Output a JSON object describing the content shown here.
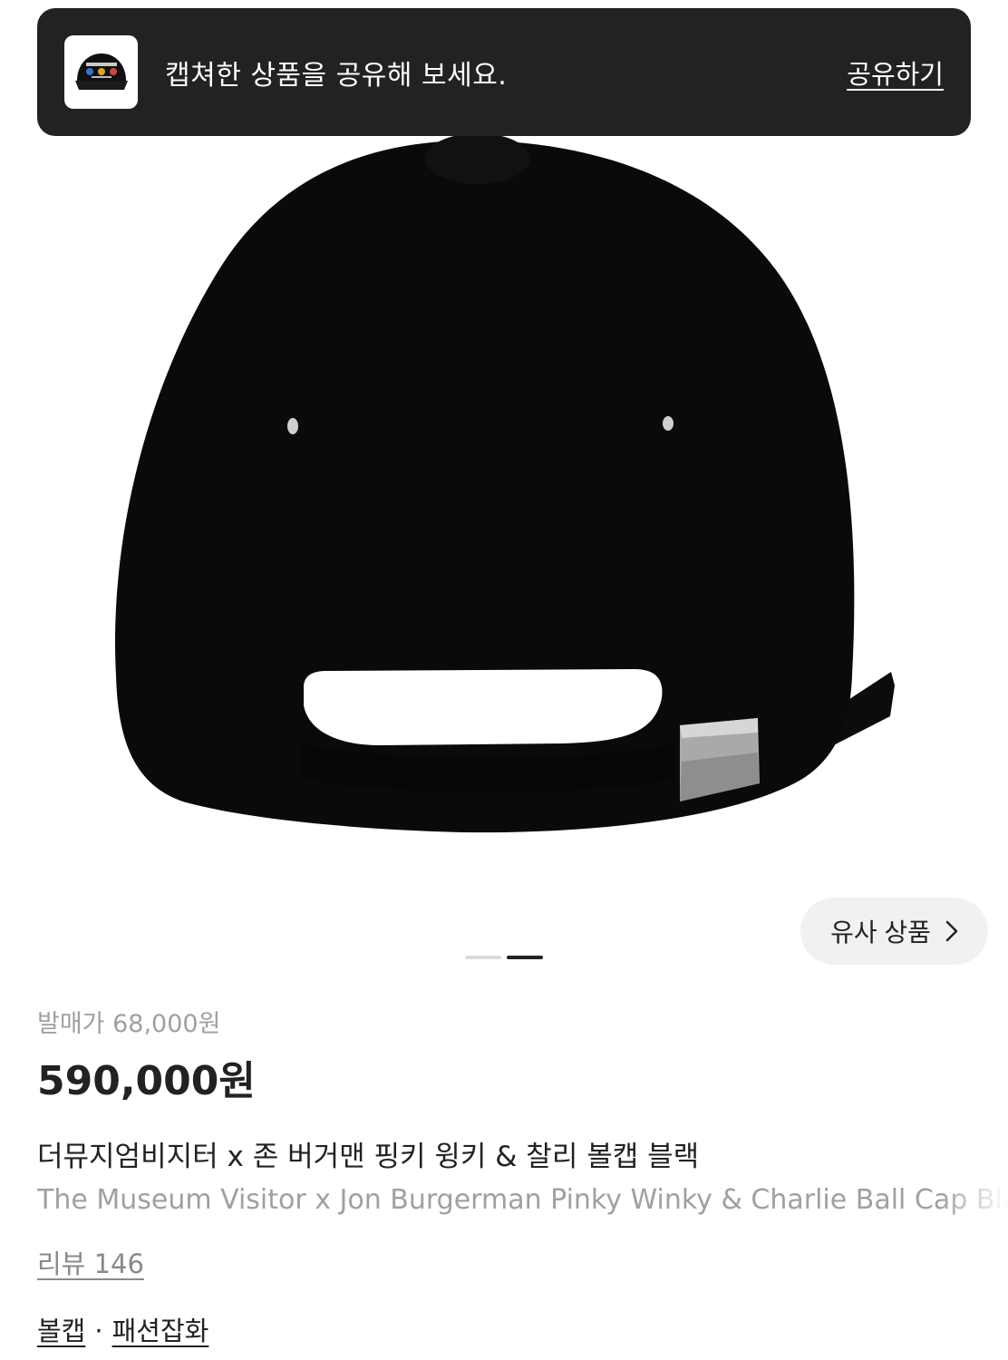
{
  "toast": {
    "message": "캡쳐한 상품을 공유해 보세요.",
    "action": "공유하기"
  },
  "product": {
    "image_icon": "black-baseball-cap-back-view",
    "similar_button": "유사 상품",
    "carousel": {
      "count": 2,
      "active_index": 1
    },
    "release_price": "발매가 68,000원",
    "price": "590,000원",
    "name_ko": "더뮤지엄비지터 x 존 버거맨 핑키 윙키 & 찰리 볼캡 블랙",
    "name_en": "The Museum Visitor x Jon Burgerman Pinky Winky & Charlie Ball Cap Black",
    "review": "리뷰 146",
    "categories": [
      "볼캡",
      "패션잡화"
    ],
    "separator": "·"
  },
  "colors": {
    "toast_bg": "#222222",
    "text_primary": "#222222",
    "text_muted": "#a0a0a0",
    "pill_bg": "#f1f1f3"
  }
}
